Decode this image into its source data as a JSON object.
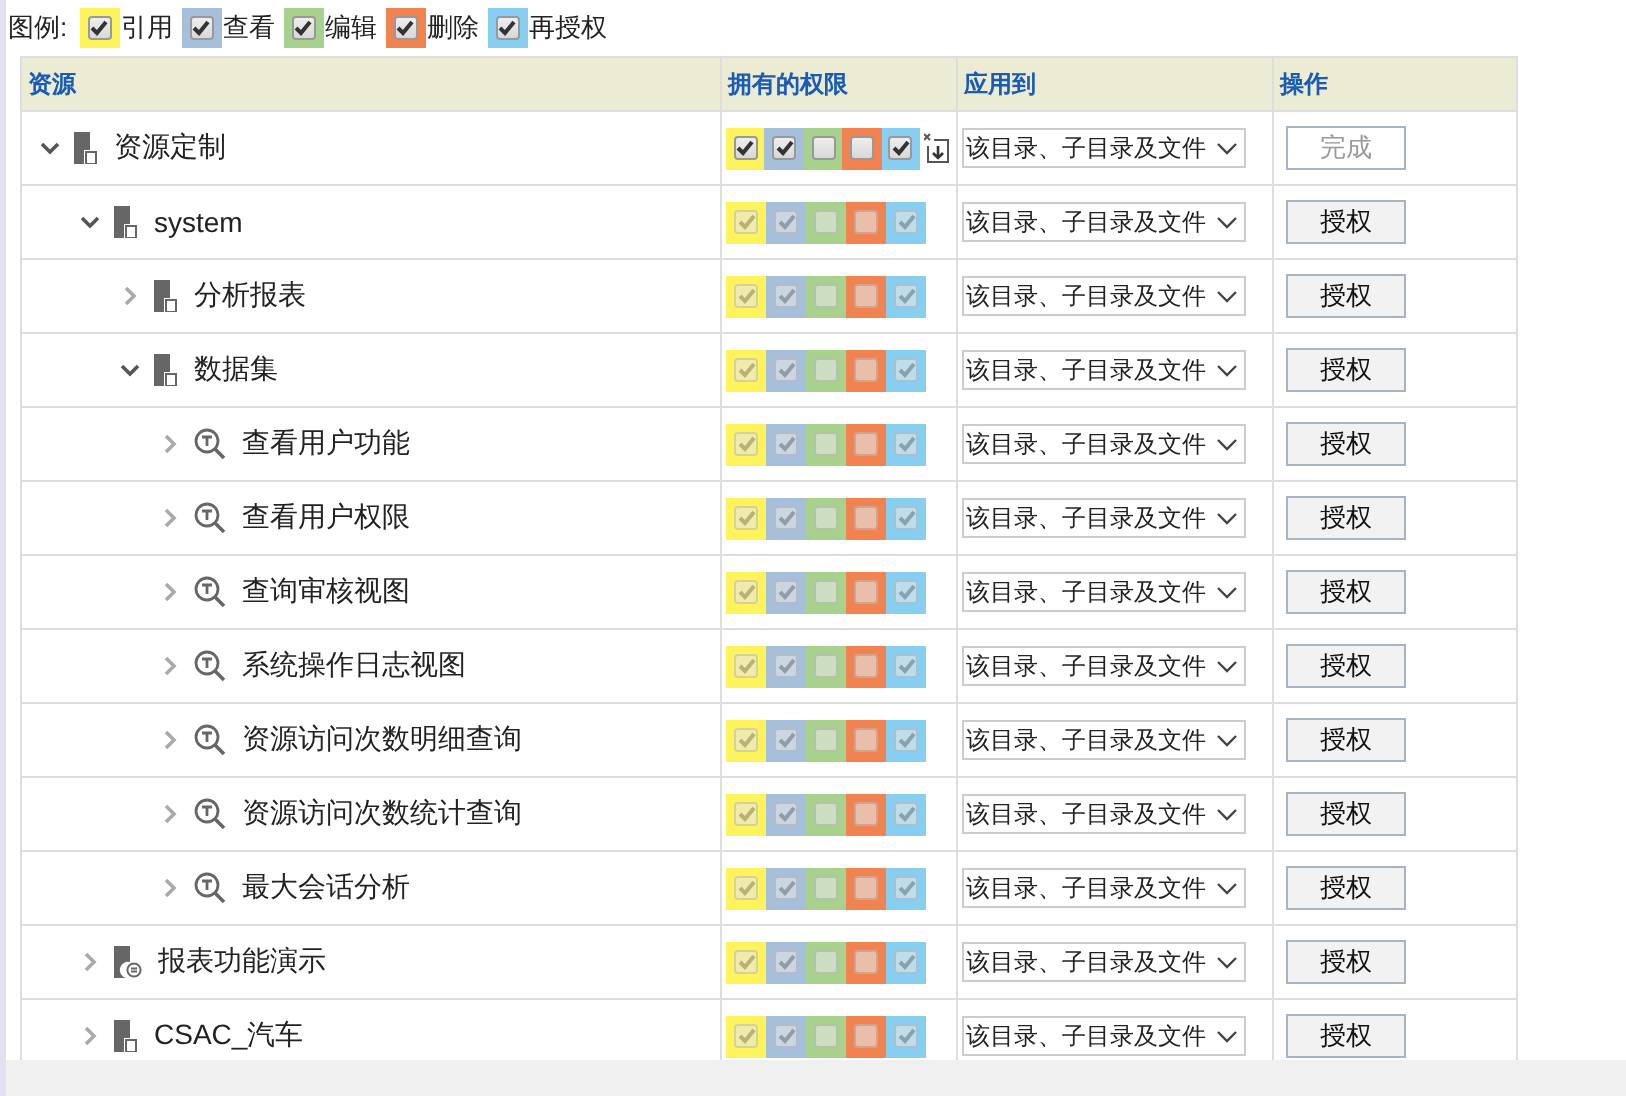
{
  "legend": {
    "title": "图例:",
    "items": [
      {
        "label": "引用",
        "color": "#fff35b",
        "checked": true
      },
      {
        "label": "查看",
        "color": "#a6bfdb",
        "checked": true
      },
      {
        "label": "编辑",
        "color": "#a9d18e",
        "checked": true
      },
      {
        "label": "删除",
        "color": "#f08350",
        "checked": true
      },
      {
        "label": "再授权",
        "color": "#87cef0",
        "checked": true
      }
    ]
  },
  "table": {
    "columns": [
      "资源",
      "拥有的权限",
      "应用到",
      "操作"
    ],
    "rows": [
      {
        "name": "资源定制",
        "kind": "folder",
        "expanded": true,
        "editable": true,
        "restore_icon": true,
        "permissions": [
          {
            "checked": true
          },
          {
            "checked": true
          },
          {
            "checked": false
          },
          {
            "checked": false
          },
          {
            "checked": true
          }
        ],
        "apply_to": "该目录、子目录及文件",
        "action": {
          "label": "完成",
          "disabled": true
        },
        "children": [
          {
            "name": "system",
            "kind": "folder",
            "expanded": true,
            "editable": false,
            "permissions": [
              {
                "checked": true
              },
              {
                "checked": true
              },
              {
                "checked": false
              },
              {
                "checked": false
              },
              {
                "checked": true
              }
            ],
            "apply_to": "该目录、子目录及文件",
            "action": {
              "label": "授权",
              "disabled": false
            },
            "children": [
              {
                "name": "分析报表",
                "kind": "folder",
                "expanded": false,
                "editable": false,
                "permissions": [
                  {
                    "checked": true
                  },
                  {
                    "checked": true
                  },
                  {
                    "checked": false
                  },
                  {
                    "checked": false
                  },
                  {
                    "checked": true
                  }
                ],
                "apply_to": "该目录、子目录及文件",
                "action": {
                  "label": "授权",
                  "disabled": false
                }
              },
              {
                "name": "数据集",
                "kind": "folder",
                "expanded": true,
                "editable": false,
                "permissions": [
                  {
                    "checked": true
                  },
                  {
                    "checked": true
                  },
                  {
                    "checked": false
                  },
                  {
                    "checked": false
                  },
                  {
                    "checked": true
                  }
                ],
                "apply_to": "该目录、子目录及文件",
                "action": {
                  "label": "授权",
                  "disabled": false
                },
                "children": [
                  {
                    "name": "查看用户功能",
                    "kind": "query",
                    "expanded": false,
                    "editable": false,
                    "permissions": [
                      {
                        "checked": true
                      },
                      {
                        "checked": true
                      },
                      {
                        "checked": false
                      },
                      {
                        "checked": false
                      },
                      {
                        "checked": true
                      }
                    ],
                    "apply_to": "该目录、子目录及文件",
                    "action": {
                      "label": "授权",
                      "disabled": false
                    }
                  },
                  {
                    "name": "查看用户权限",
                    "kind": "query",
                    "expanded": false,
                    "editable": false,
                    "permissions": [
                      {
                        "checked": true
                      },
                      {
                        "checked": true
                      },
                      {
                        "checked": false
                      },
                      {
                        "checked": false
                      },
                      {
                        "checked": true
                      }
                    ],
                    "apply_to": "该目录、子目录及文件",
                    "action": {
                      "label": "授权",
                      "disabled": false
                    }
                  },
                  {
                    "name": "查询审核视图",
                    "kind": "query",
                    "expanded": false,
                    "editable": false,
                    "permissions": [
                      {
                        "checked": true
                      },
                      {
                        "checked": true
                      },
                      {
                        "checked": false
                      },
                      {
                        "checked": false
                      },
                      {
                        "checked": true
                      }
                    ],
                    "apply_to": "该目录、子目录及文件",
                    "action": {
                      "label": "授权",
                      "disabled": false
                    }
                  },
                  {
                    "name": "系统操作日志视图",
                    "kind": "query",
                    "expanded": false,
                    "editable": false,
                    "permissions": [
                      {
                        "checked": true
                      },
                      {
                        "checked": true
                      },
                      {
                        "checked": false
                      },
                      {
                        "checked": false
                      },
                      {
                        "checked": true
                      }
                    ],
                    "apply_to": "该目录、子目录及文件",
                    "action": {
                      "label": "授权",
                      "disabled": false
                    }
                  },
                  {
                    "name": "资源访问次数明细查询",
                    "kind": "query",
                    "expanded": false,
                    "editable": false,
                    "permissions": [
                      {
                        "checked": true
                      },
                      {
                        "checked": true
                      },
                      {
                        "checked": false
                      },
                      {
                        "checked": false
                      },
                      {
                        "checked": true
                      }
                    ],
                    "apply_to": "该目录、子目录及文件",
                    "action": {
                      "label": "授权",
                      "disabled": false
                    }
                  },
                  {
                    "name": "资源访问次数统计查询",
                    "kind": "query",
                    "expanded": false,
                    "editable": false,
                    "permissions": [
                      {
                        "checked": true
                      },
                      {
                        "checked": true
                      },
                      {
                        "checked": false
                      },
                      {
                        "checked": false
                      },
                      {
                        "checked": true
                      }
                    ],
                    "apply_to": "该目录、子目录及文件",
                    "action": {
                      "label": "授权",
                      "disabled": false
                    }
                  },
                  {
                    "name": "最大会话分析",
                    "kind": "query",
                    "expanded": false,
                    "editable": false,
                    "permissions": [
                      {
                        "checked": true
                      },
                      {
                        "checked": true
                      },
                      {
                        "checked": false
                      },
                      {
                        "checked": false
                      },
                      {
                        "checked": true
                      }
                    ],
                    "apply_to": "该目录、子目录及文件",
                    "action": {
                      "label": "授权",
                      "disabled": false
                    }
                  }
                ]
              }
            ]
          },
          {
            "name": "报表功能演示",
            "kind": "report",
            "expanded": false,
            "editable": false,
            "permissions": [
              {
                "checked": true
              },
              {
                "checked": true
              },
              {
                "checked": false
              },
              {
                "checked": false
              },
              {
                "checked": true
              }
            ],
            "apply_to": "该目录、子目录及文件",
            "action": {
              "label": "授权",
              "disabled": false
            }
          },
          {
            "name": "CSAC_汽车",
            "kind": "folder",
            "expanded": false,
            "editable": false,
            "permissions": [
              {
                "checked": true
              },
              {
                "checked": true
              },
              {
                "checked": false
              },
              {
                "checked": false
              },
              {
                "checked": true
              }
            ],
            "apply_to": "该目录、子目录及文件",
            "action": {
              "label": "授权",
              "disabled": false
            }
          }
        ]
      }
    ]
  }
}
